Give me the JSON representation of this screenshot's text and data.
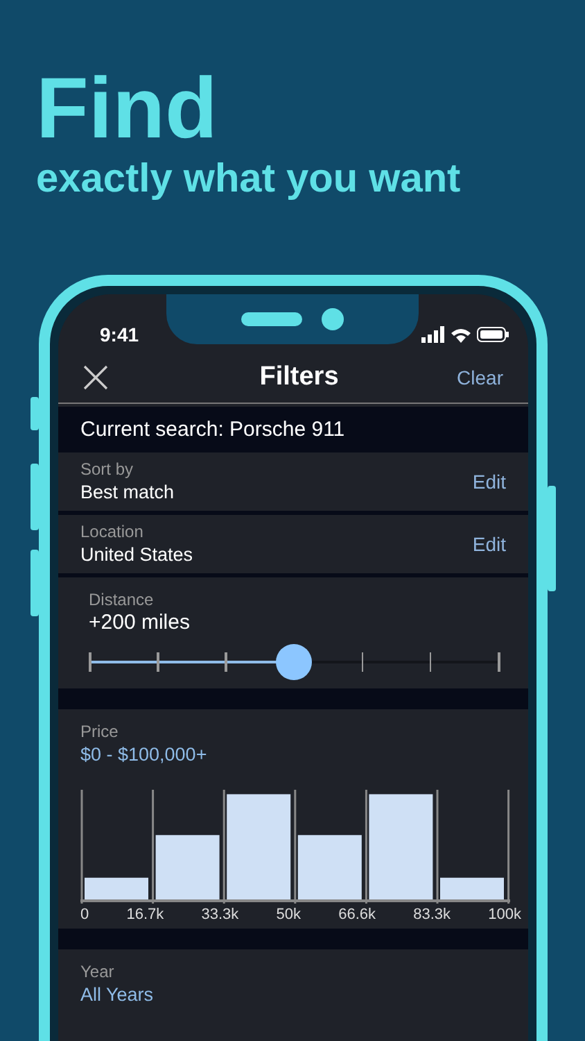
{
  "headline": {
    "title": "Find",
    "subtitle": "exactly what you want"
  },
  "status_bar": {
    "time": "9:41"
  },
  "header": {
    "title": "Filters",
    "action": "Clear"
  },
  "current_search": "Current search: Porsche 911",
  "rows": [
    {
      "label": "Sort by",
      "value": "Best match",
      "action": "Edit"
    },
    {
      "label": "Location",
      "value": "United States",
      "action": "Edit"
    }
  ],
  "distance": {
    "label": "Distance",
    "value": "+200 miles",
    "level": 0.5
  },
  "price": {
    "label": "Price",
    "value": "$0 - $100,000+",
    "axis_labels": [
      "0",
      "16.7k",
      "33.3k",
      "50k",
      "66.6k",
      "83.3k",
      "100k"
    ]
  },
  "year": {
    "label": "Year",
    "value": "All Years"
  }
}
